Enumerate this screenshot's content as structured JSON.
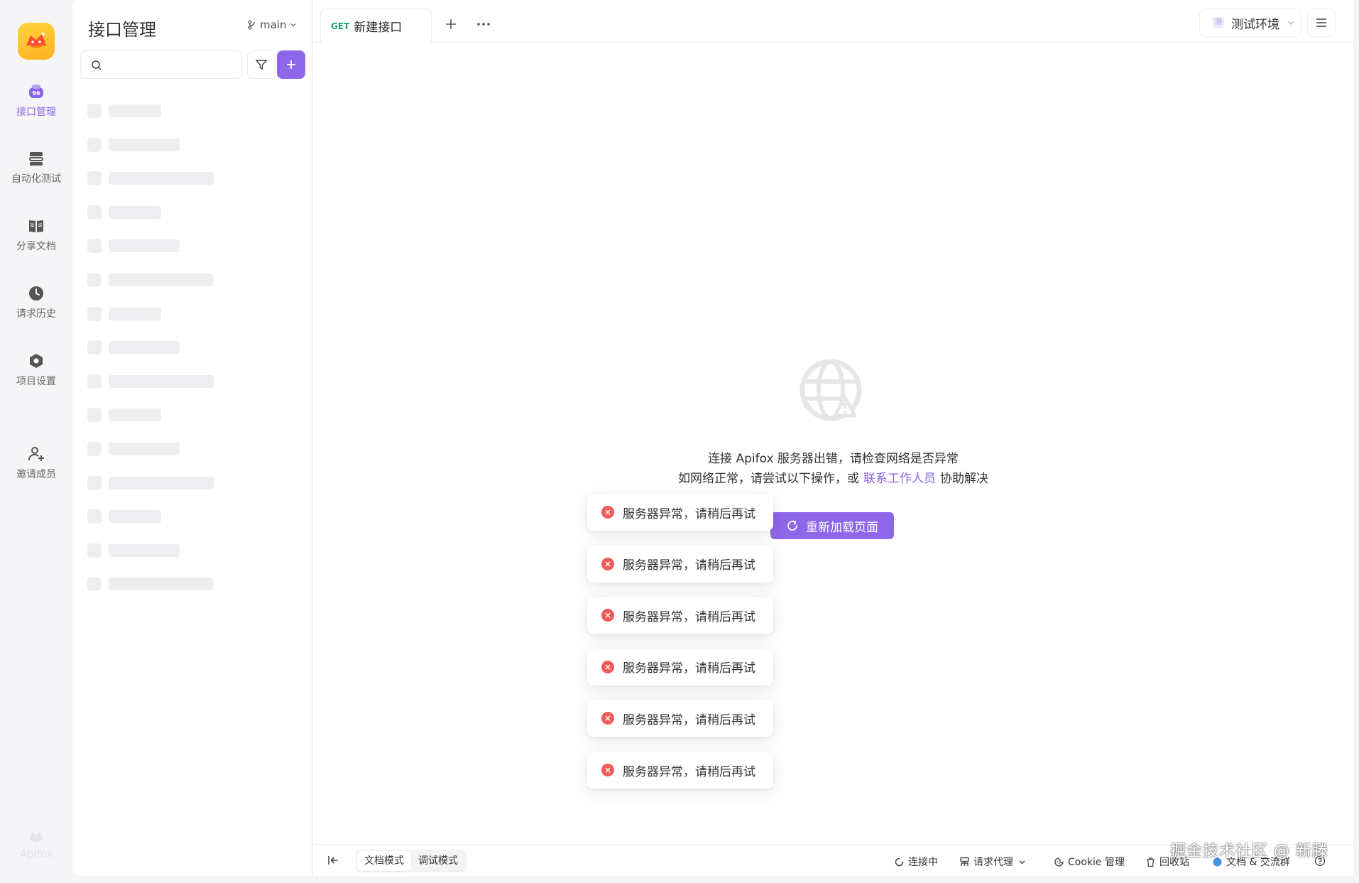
{
  "nav": {
    "brand": "Apifox",
    "items": [
      {
        "label": "接口管理",
        "icon": "api-manage-icon",
        "active": true
      },
      {
        "label": "自动化测试",
        "icon": "automation-icon",
        "active": false
      },
      {
        "label": "分享文档",
        "icon": "book-icon",
        "active": false
      },
      {
        "label": "请求历史",
        "icon": "clock-icon",
        "active": false
      },
      {
        "label": "项目设置",
        "icon": "hexagon-settings-icon",
        "active": false
      },
      {
        "label": "邀请成员",
        "icon": "add-user-icon",
        "active": false
      }
    ]
  },
  "tree": {
    "title": "接口管理",
    "branch": "main",
    "search_placeholder": ""
  },
  "tab": {
    "method": "GET",
    "name": "新建接口"
  },
  "env": {
    "badge": "测",
    "label": "测试环境"
  },
  "error": {
    "line1": "连接 Apifox 服务器出错，请检查网络是否异常",
    "line2_prefix": "如网络正常，请尝试以下操作，或",
    "line2_link": "联系工作人员",
    "line2_suffix": "协助解决",
    "reload_label": "重新加载页面"
  },
  "toasts": [
    "服务器异常，请稍后再试",
    "服务器异常，请稍后再试",
    "服务器异常，请稍后再试",
    "服务器异常，请稍后再试",
    "服务器异常，请稍后再试",
    "服务器异常，请稍后再试"
  ],
  "bottom": {
    "mode_doc": "文档模式",
    "mode_debug": "调试模式",
    "connecting": "连接中",
    "proxy": "请求代理",
    "cookie": "Cookie 管理",
    "recycle": "回收站",
    "docs": "文档 & 交流群"
  },
  "watermark": "掘金技术社区 @ 新滕",
  "colors": {
    "accent": "#8e66ea",
    "get": "#1aa265",
    "error": "#f05a5a"
  }
}
